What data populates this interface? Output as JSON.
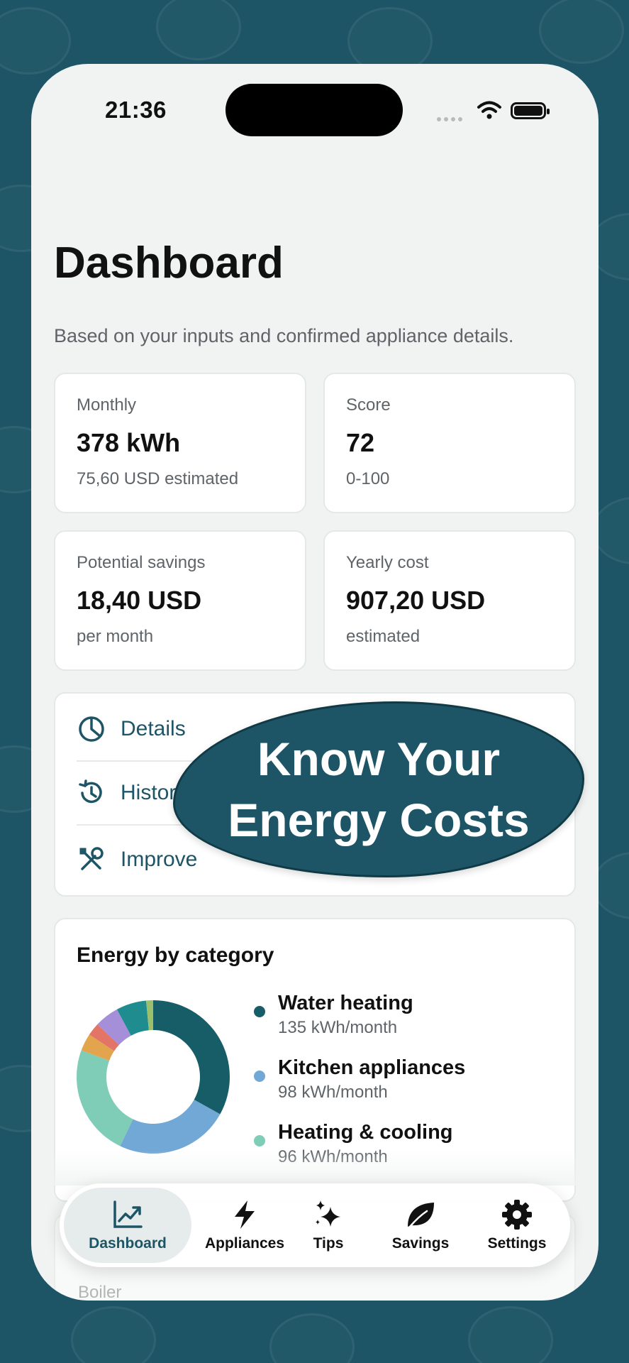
{
  "status": {
    "time": "21:36"
  },
  "header": {
    "title": "Dashboard",
    "subtitle": "Based on your inputs and confirmed appliance details."
  },
  "stats": [
    {
      "label": "Monthly",
      "value": "378 kWh",
      "sub": "75,60 USD estimated"
    },
    {
      "label": "Score",
      "value": "72",
      "sub": "0-100"
    },
    {
      "label": "Potential savings",
      "value": "18,40 USD",
      "sub": "per month"
    },
    {
      "label": "Yearly cost",
      "value": "907,20 USD",
      "sub": "estimated"
    }
  ],
  "links": [
    {
      "label": "Details",
      "icon": "pie-chart-icon"
    },
    {
      "label": "Histor",
      "icon": "history-icon"
    },
    {
      "label": "Improve",
      "icon": "tools-icon"
    }
  ],
  "promo": {
    "line1": "Know Your",
    "line2": "Energy Costs"
  },
  "chart_data": {
    "type": "pie",
    "title": "Energy by category",
    "slices": [
      {
        "name": "Water heating",
        "value": 135,
        "label": "135 kWh/month",
        "color": "#175d68"
      },
      {
        "name": "Kitchen appliances",
        "value": 98,
        "label": "98 kWh/month",
        "color": "#72a8d6"
      },
      {
        "name": "Heating & cooling",
        "value": 96,
        "label": "96 kWh/month",
        "color": "#7fcdb7"
      },
      {
        "name": "",
        "value": 15,
        "color": "#e2a54e"
      },
      {
        "name": "",
        "value": 11,
        "color": "#e27566"
      },
      {
        "name": "",
        "value": 21,
        "color": "#a48fd8"
      },
      {
        "name": "",
        "value": 26,
        "color": "#1f8c8f"
      },
      {
        "name": "",
        "value": 6,
        "color": "#9bbf6a"
      }
    ]
  },
  "partial": {
    "boiler": "Boiler"
  },
  "tabs": [
    {
      "label": "Dashboard",
      "icon": "chart-trend-icon",
      "active": true
    },
    {
      "label": "Appliances",
      "icon": "bolt-icon"
    },
    {
      "label": "Tips",
      "icon": "sparkles-icon"
    },
    {
      "label": "Savings",
      "icon": "leaf-icon"
    },
    {
      "label": "Settings",
      "icon": "gear-icon"
    }
  ],
  "colors": {
    "accent": "#1d5566",
    "background": "#f1f3f3"
  }
}
